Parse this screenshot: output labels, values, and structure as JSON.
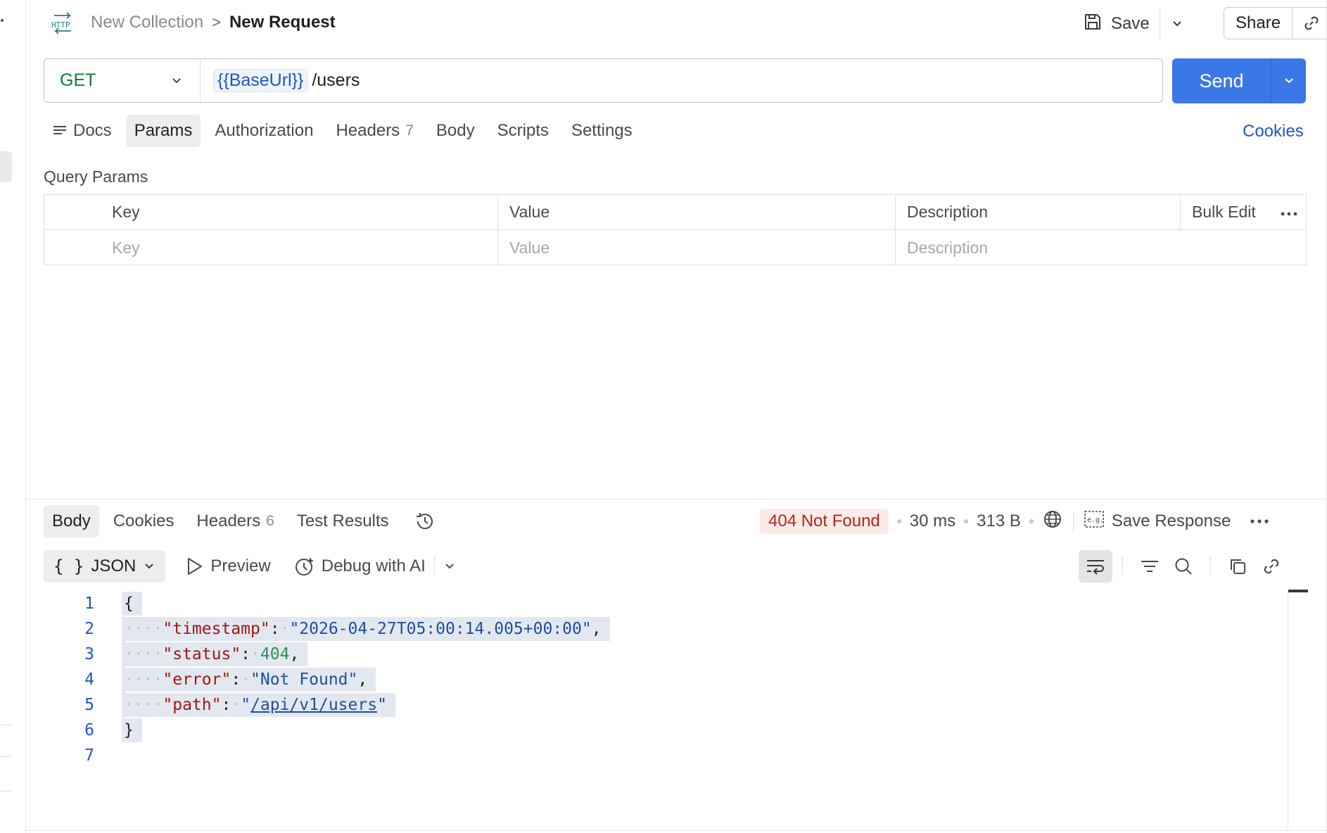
{
  "header": {
    "http_icon_text": "HTTP",
    "collection": "New Collection",
    "separator": ">",
    "request": "New Request",
    "save_label": "Save",
    "share_label": "Share"
  },
  "url_bar": {
    "method": "GET",
    "url_variable": "{{BaseUrl}}",
    "url_path": "/users",
    "send_label": "Send"
  },
  "request_tabs": {
    "docs": "Docs",
    "params": "Params",
    "authorization": "Authorization",
    "headers": "Headers",
    "headers_count": "7",
    "body": "Body",
    "scripts": "Scripts",
    "settings": "Settings",
    "cookies": "Cookies",
    "active": "Params"
  },
  "query_params": {
    "label": "Query Params",
    "columns": [
      "Key",
      "Value",
      "Description"
    ],
    "bulk_edit": "Bulk Edit",
    "placeholders": [
      "Key",
      "Value",
      "Description"
    ]
  },
  "response_tabs": {
    "body": "Body",
    "cookies": "Cookies",
    "headers": "Headers",
    "headers_count": "6",
    "test_results": "Test Results",
    "active": "Body"
  },
  "response_meta": {
    "status": "404 Not Found",
    "time": "30 ms",
    "size": "313 B",
    "save_response": "Save Response",
    "status_color": "#b3261e"
  },
  "viewer": {
    "format": "JSON",
    "preview": "Preview",
    "debug": "Debug with AI"
  },
  "code": {
    "line_numbers": [
      "1",
      "2",
      "3",
      "4",
      "5",
      "6",
      "7"
    ],
    "open_brace": "{",
    "close_brace": "}",
    "timestamp_key": "\"timestamp\"",
    "timestamp_value": "\"2026-04-27T05:00:14.005+00:00\"",
    "status_key": "\"status\"",
    "status_value": "404",
    "error_key": "\"error\"",
    "error_value": "\"Not Found\"",
    "path_key": "\"path\"",
    "path_value_open": "\"",
    "path_value": "/api/v1/users",
    "path_value_close": "\""
  },
  "colors": {
    "accent": "#3b78e7",
    "method_get": "#0f7a3a",
    "json_key": "#a31515",
    "json_string": "#1f4fa0",
    "json_number": "#2f8f5a"
  }
}
